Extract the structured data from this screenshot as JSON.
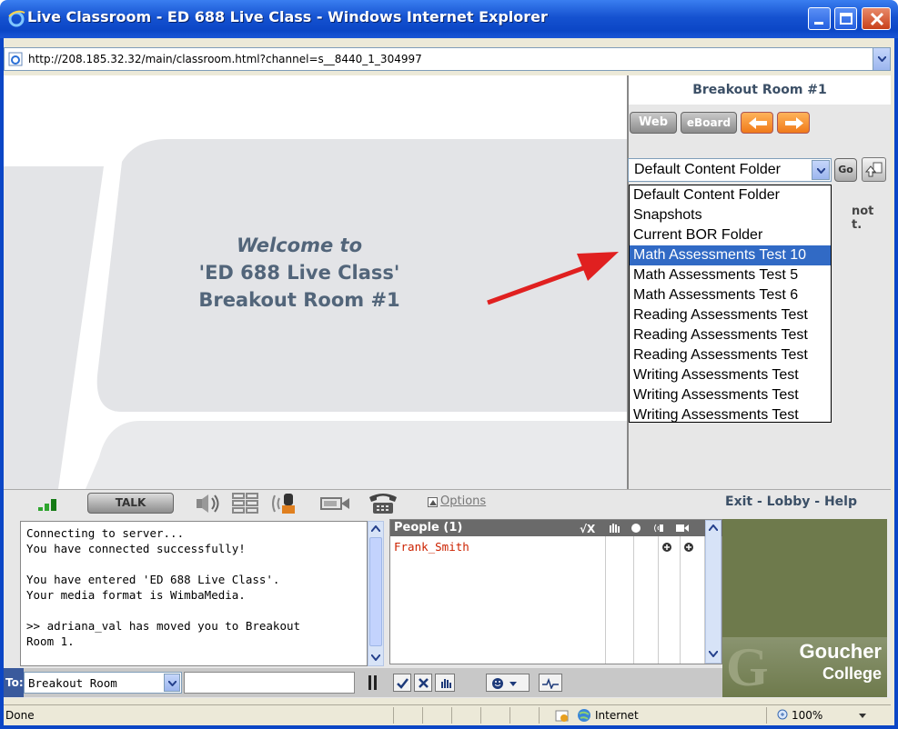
{
  "window": {
    "title": "Live Classroom - ED 688 Live Class - Windows Internet Explorer"
  },
  "address": {
    "url": "http://208.185.32.32/main/classroom.html?channel=s__8440_1_304997"
  },
  "stage": {
    "welcome_line1": "Welcome to",
    "welcome_line2": "'ED 688 Live Class'",
    "welcome_line3": "Breakout Room #1"
  },
  "right_panel": {
    "room_title": "Breakout Room #1",
    "web_label": "Web",
    "eboard_label": "eBoard",
    "folder_selected": "Default Content Folder",
    "go_label": "Go",
    "partial_text_1": "not",
    "partial_text_2": "t.",
    "folder_options": [
      "Default Content Folder",
      "Snapshots",
      "Current BOR Folder",
      "Math Assessments Test 10",
      "Math Assessments Test 5",
      "Math Assessments Test 6",
      "Reading Assessments Test",
      "Reading Assessments Test",
      "Reading Assessments Test",
      "Writing Assessments Test",
      "Writing Assessments Test",
      "Writing Assessments Test"
    ],
    "highlighted_index": 3
  },
  "controls": {
    "talk_label": "TALK",
    "options_label": "Options",
    "exit_label": "Exit",
    "lobby_label": "Lobby",
    "help_label": "Help",
    "sep": " - "
  },
  "chat": {
    "lines": [
      "Connecting to server...",
      "You have connected successfully!",
      "",
      "You have entered 'ED 688 Live Class'.",
      "Your media format is WimbaMedia.",
      "",
      ">> adriana_val has moved you to Breakout",
      "Room 1."
    ]
  },
  "people": {
    "header": "People (1)",
    "members": [
      "Frank_Smith"
    ]
  },
  "to_bar": {
    "to_label": "To:",
    "recipient": "Breakout Room"
  },
  "logo": {
    "line1": "Goucher",
    "line2": "College"
  },
  "status": {
    "left": "Done",
    "zone": "Internet",
    "zoom": "100%"
  },
  "colors": {
    "titlebar": "#0b46c6",
    "highlight": "#316ac5",
    "arrow": "#e02020",
    "member": "#cc2200",
    "video_bg": "#6e7a4c"
  }
}
